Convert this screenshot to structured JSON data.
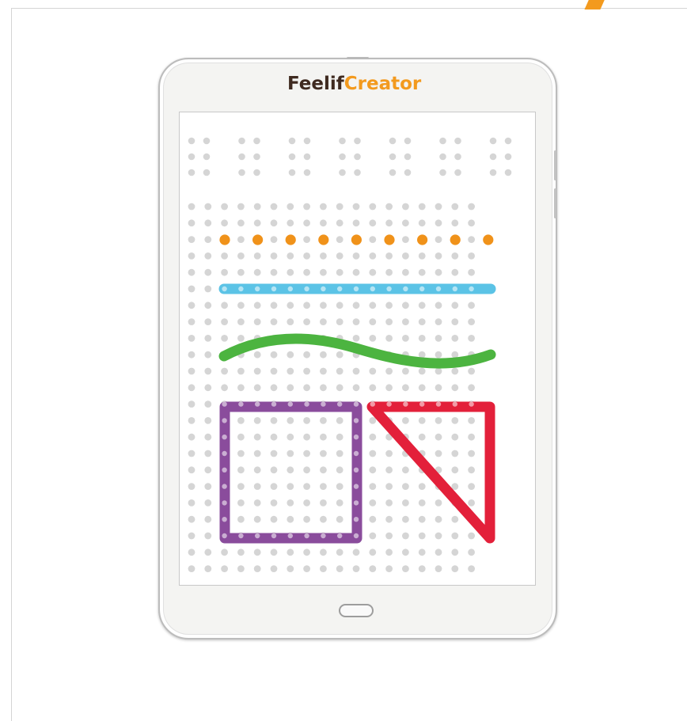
{
  "app": {
    "brand_part1": "Feelif",
    "brand_part2": "Creator"
  },
  "colors": {
    "brand_dark": "#3f2a20",
    "brand_accent": "#f39a1e",
    "pin_off": "#d5d5d5",
    "pin_orange": "#f0921a",
    "line_blue": "#5bc3e6",
    "wave_green": "#4cb440",
    "square_purple": "#8a4c9c",
    "triangle_red": "#e3203a"
  },
  "icons": {
    "home_button": "home-button-icon",
    "corner_mark": "orange-slash-icon"
  },
  "braille": {
    "cells": 7
  },
  "pin_grid": {
    "columns": 18,
    "rows": 23
  },
  "shapes": [
    {
      "name": "orange-dot-row",
      "kind": "dots"
    },
    {
      "name": "blue-line",
      "kind": "line"
    },
    {
      "name": "green-wave",
      "kind": "curve"
    },
    {
      "name": "purple-square",
      "kind": "square"
    },
    {
      "name": "red-triangle",
      "kind": "triangle"
    }
  ]
}
